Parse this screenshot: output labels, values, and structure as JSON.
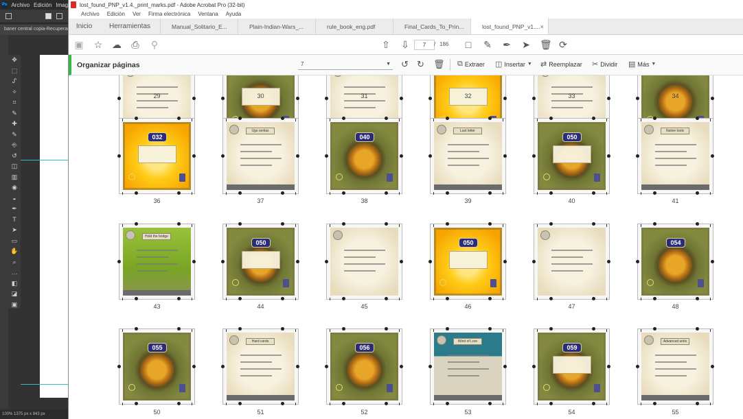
{
  "photoshop": {
    "menus": [
      "Archivo",
      "Edición",
      "Imagen"
    ],
    "tab_label": "baner central copia-Recuperado",
    "status": "100%   1375 px x 843 px",
    "tool_icons": [
      "move-tool-icon",
      "marquee-tool-icon",
      "lasso-tool-icon",
      "magic-wand-icon",
      "crop-tool-icon",
      "eyedropper-icon",
      "healing-brush-icon",
      "brush-tool-icon",
      "stamp-tool-icon",
      "history-brush-icon",
      "eraser-icon",
      "gradient-tool-icon",
      "blur-tool-icon",
      "dodge-tool-icon",
      "pen-tool-icon",
      "type-tool-icon",
      "path-select-icon",
      "shape-tool-icon",
      "hand-tool-icon",
      "zoom-tool-icon",
      "more-tools-icon",
      "color-swatch-icon",
      "quick-mask-icon",
      "screen-mode-icon"
    ]
  },
  "acrobat": {
    "window_title": "lost_found_PNP_v1.4._print_marks.pdf - Adobe Acrobat Pro (32-bit)",
    "menu": [
      "Archivo",
      "Edición",
      "Ver",
      "Firma electrónica",
      "Ventana",
      "Ayuda"
    ],
    "home_tab": "Inicio",
    "tools_tab": "Herramientas",
    "doc_tabs": [
      {
        "label": "Manual_Solitario_E...",
        "active": false
      },
      {
        "label": "Plain-Indian-Wars_...",
        "active": false
      },
      {
        "label": "rule_book_eng.pdf",
        "active": false
      },
      {
        "label": "Final_Cards_To_Prin...",
        "active": false
      },
      {
        "label": "lost_found_PNP_v1....",
        "active": true
      }
    ],
    "close_glyph": "×",
    "toolbar": {
      "current_page": "7",
      "page_sep": "/",
      "total_pages": "186"
    },
    "organize": {
      "title": "Organizar páginas",
      "page_range": "7",
      "extract": "Extraer",
      "insert": "Insertar",
      "replace": "Reemplazar",
      "split": "Dividir",
      "more": "Más"
    },
    "pages": [
      {
        "num": "29",
        "style": "parch"
      },
      {
        "num": "30",
        "style": "green"
      },
      {
        "num": "31",
        "style": "parch"
      },
      {
        "num": "32",
        "style": "yellow"
      },
      {
        "num": "33",
        "style": "parch"
      },
      {
        "num": "34",
        "style": "green"
      },
      {
        "num": "36",
        "style": "yellow",
        "badge": "032",
        "title": ""
      },
      {
        "num": "37",
        "style": "parch",
        "badge": "",
        "title": "Ugo serilas"
      },
      {
        "num": "38",
        "style": "green",
        "badge": "040",
        "title": ""
      },
      {
        "num": "39",
        "style": "parch",
        "badge": "",
        "title": "Last letter"
      },
      {
        "num": "40",
        "style": "green",
        "badge": "050",
        "title": ""
      },
      {
        "num": "41",
        "style": "parch",
        "badge": "",
        "title": "Native tools"
      },
      {
        "num": "43",
        "style": "grass",
        "badge": "",
        "title": "Hold the bridge"
      },
      {
        "num": "44",
        "style": "green",
        "badge": "050",
        "title": ""
      },
      {
        "num": "45",
        "style": "parch",
        "badge": "",
        "title": ""
      },
      {
        "num": "46",
        "style": "yellow",
        "badge": "050",
        "title": ""
      },
      {
        "num": "47",
        "style": "parch",
        "badge": "",
        "title": ""
      },
      {
        "num": "48",
        "style": "green",
        "badge": "054",
        "title": ""
      },
      {
        "num": "50",
        "style": "green",
        "badge": "055",
        "title": ""
      },
      {
        "num": "51",
        "style": "parch",
        "badge": "",
        "title": "Hard cards"
      },
      {
        "num": "52",
        "style": "green",
        "badge": "056",
        "title": ""
      },
      {
        "num": "53",
        "style": "teal",
        "badge": "",
        "title": "Wind of Lore"
      },
      {
        "num": "54",
        "style": "green",
        "badge": "059",
        "title": ""
      },
      {
        "num": "55",
        "style": "parch",
        "badge": "",
        "title": "Advanced units"
      }
    ],
    "colors": {
      "accent_green": "#3ab54a",
      "badge_navy": "#2a2c78"
    }
  }
}
